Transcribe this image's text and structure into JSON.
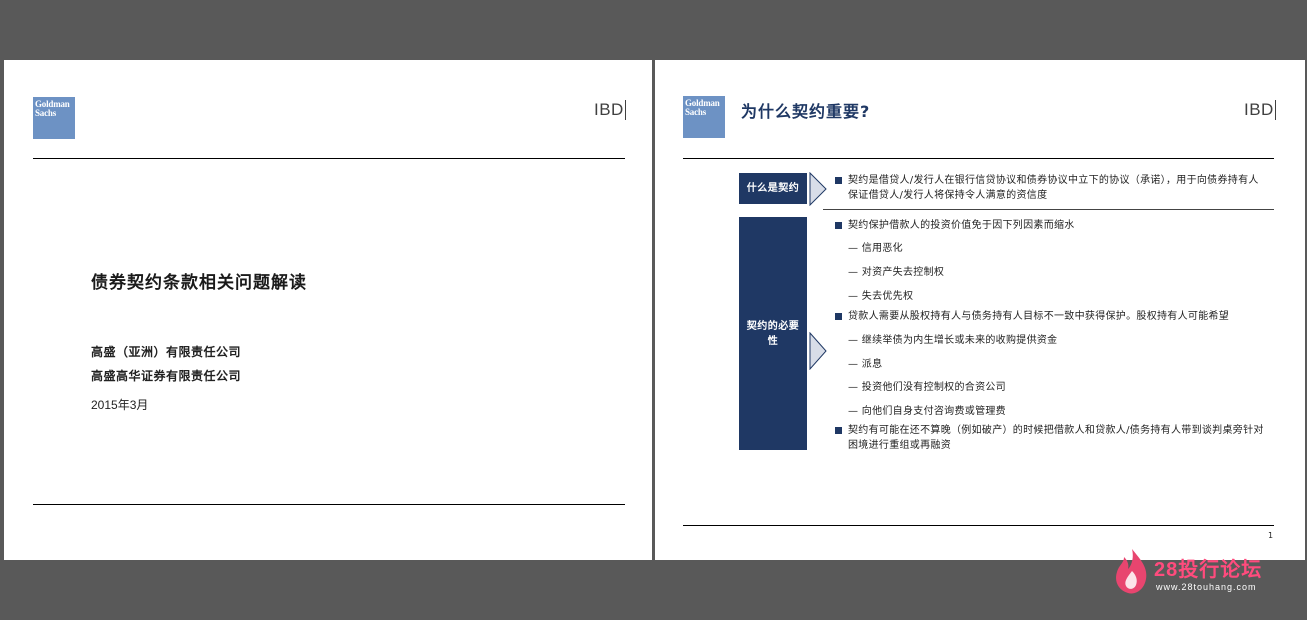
{
  "slide1": {
    "logo_text": "Goldman Sachs",
    "ibd": "IBD",
    "title": "债券契约条款相关问题解读",
    "companies": [
      "高盛（亚洲）有限责任公司",
      "高盛高华证券有限责任公司"
    ],
    "date": "2015年3月"
  },
  "slide2": {
    "logo_text": "Goldman Sachs",
    "ibd": "IBD",
    "title": "为什么契约重要?",
    "section1_label": "什么是契约",
    "section1_bullet": "契约是借贷人/发行人在银行信贷协议和债券协议中立下的协议（承诺），用于向债券持有人保证借贷人/发行人将保持令人满意的资信度",
    "section2_label": "契约的必要性",
    "section2_items": [
      {
        "type": "bullet",
        "text": "契约保护借款人的投资价值免于因下列因素而缩水"
      },
      {
        "type": "dash",
        "text": "— 信用恶化"
      },
      {
        "type": "dash",
        "text": "— 对资产失去控制权"
      },
      {
        "type": "dash",
        "text": "— 失去优先权"
      },
      {
        "type": "bullet",
        "text": "贷款人需要从股权持有人与债务持有人目标不一致中获得保护。股权持有人可能希望"
      },
      {
        "type": "dash",
        "text": "— 继续举债为内生增长或未来的收购提供资金"
      },
      {
        "type": "dash",
        "text": "— 派息"
      },
      {
        "type": "dash",
        "text": "— 投资他们没有控制权的合资公司"
      },
      {
        "type": "dash",
        "text": "— 向他们自身支付咨询费或管理费"
      },
      {
        "type": "bullet",
        "text": "契约有可能在还不算晚（例如破产）的时候把借款人和贷款人/债务持有人带到谈判桌旁针对困境进行重组或再融资"
      }
    ],
    "page_number": "1"
  },
  "watermark": {
    "brand": "28投行论坛",
    "url": "www.28touhang.com"
  },
  "colors": {
    "background": "#595959",
    "navy": "#1f3864",
    "logo_blue": "#6d92c4",
    "watermark_pink": "#ff4b7d"
  }
}
